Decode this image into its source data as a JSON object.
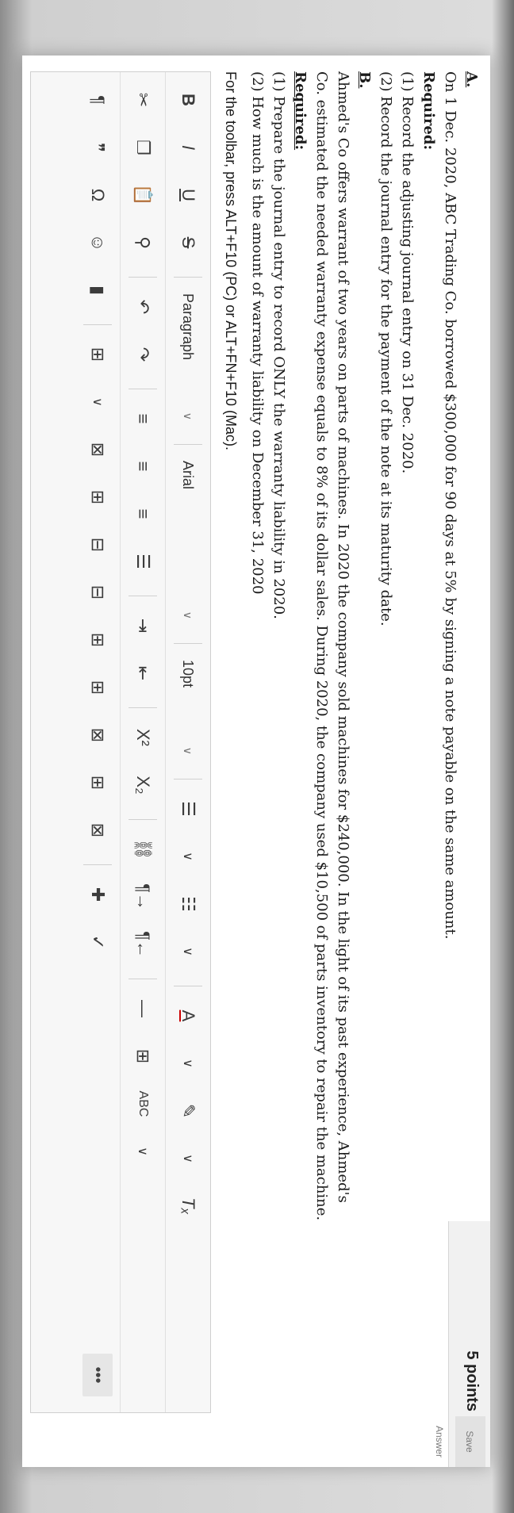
{
  "header": {
    "points": "5 points",
    "save_button": "Save Answer"
  },
  "question": {
    "section_a_label": "A.",
    "a_text": "On 1 Dec. 2020, ABC Trading Co. borrowed $300,000 for 90 days at 5% by signing a note payable on the same amount.",
    "a_required_label": "Required:",
    "a_req1": "(1) Record the adjusting journal entry on 31 Dec. 2020.",
    "a_req2": "(2) Record the journal entry for the payment of the note at its maturity date.",
    "section_b_label": "B.",
    "b_text1": "Ahmed's Co offers warrant of two years on parts of machines. In 2020 the company sold machines for $240,000. In the light of its past experience, Ahmed's",
    "b_text2": "Co. estimated the needed warranty expense equals to 8% of its dollar sales. During 2020, the company used $10,500 of parts inventory to repair the machine.",
    "b_required_label": "Required:",
    "b_req1": "(1) Prepare the journal entry to record ONLY the warranty liability in 2020.",
    "b_req2": "(2) How much is the amount of warranty liability on December 31, 2020"
  },
  "toolbar_note": "For the toolbar, press ALT+F10 (PC) or ALT+FN+F10 (Mac).",
  "toolbar": {
    "row1": {
      "bold": "B",
      "italic": "I",
      "underline": "U",
      "strike": "S",
      "paragraph": "Paragraph",
      "font": "Arial",
      "size": "10pt"
    },
    "row2": {
      "cut": "✂",
      "copy": "❐",
      "paste": "📋",
      "find": "⚲",
      "undo": "↶",
      "redo": "↷",
      "superscript": "X²",
      "subscript": "X₂"
    },
    "row3": {
      "paragraph_mark": "¶",
      "quote": "❞",
      "omega": "Ω",
      "emoji": "☺",
      "rtl": "¶←",
      "ltr": "¶→",
      "hr": "—",
      "more": "•••"
    }
  },
  "icon_names": [
    "scissors-icon",
    "copy-icon",
    "paste-icon",
    "search-icon",
    "undo-icon",
    "redo-icon",
    "align-left-icon",
    "align-center-icon",
    "align-right-icon",
    "justify-icon",
    "indent-icon",
    "outdent-icon",
    "bullet-list-icon",
    "numbered-list-icon",
    "link-icon",
    "unlink-icon",
    "text-color-icon",
    "highlight-icon",
    "clear-format-icon",
    "table-icon",
    "image-icon",
    "spellcheck-icon"
  ]
}
